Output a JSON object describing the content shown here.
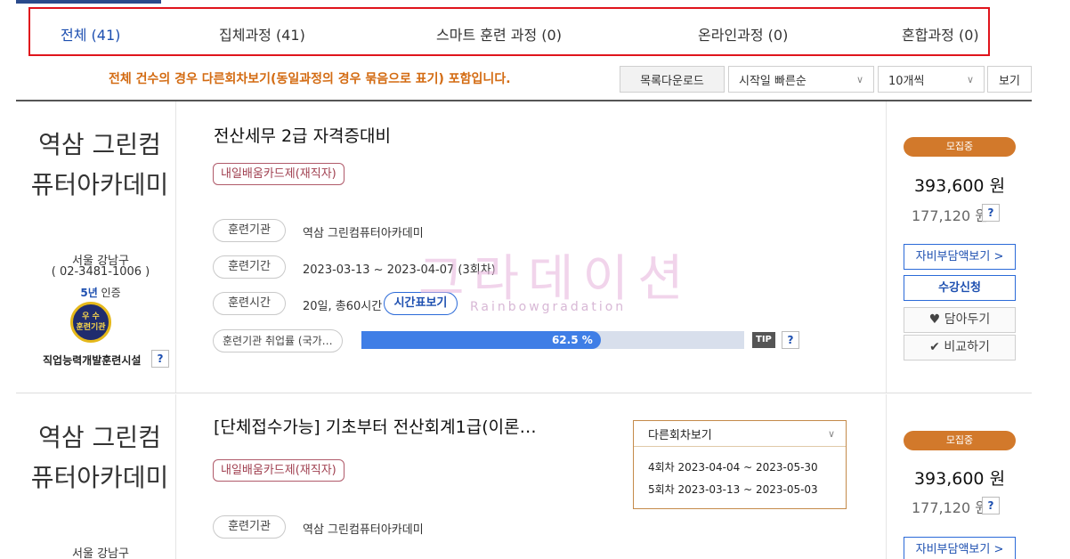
{
  "tabs": [
    {
      "label": "전체 (41)",
      "active": true
    },
    {
      "label": "집체과정 (41)",
      "active": false
    },
    {
      "label": "스마트 훈련 과정 (0)",
      "active": false
    },
    {
      "label": "온라인과정 (0)",
      "active": false
    },
    {
      "label": "혼합과정 (0)",
      "active": false
    }
  ],
  "notice": "전체 건수의 경우 다른회차보기(동일과정의 경우 묶음으로 표기) 포함입니다.",
  "toolbar": {
    "download_label": "목록다운로드",
    "sort_value": "시작일 빠른순",
    "page_size_value": "10개씩",
    "view_label": "보기"
  },
  "watermark": {
    "main": "그라데이션",
    "sub": "Rainbowgradation"
  },
  "courses": [
    {
      "org_name": "역삼 그린컴퓨터아카데미",
      "org_addr": "서울 강남구",
      "org_phone": "( 02-3481-1006 )",
      "cert_years": "5년",
      "cert_suffix": " 인증",
      "medal_text": "우 수\n훈련기관",
      "org_type": "직업능력개발훈련시설",
      "title": "전산세무 2급 자격증대비",
      "tag": "내일배움카드제(재직자)",
      "labels": {
        "org": "훈련기관",
        "period": "훈련기간",
        "time": "훈련시간",
        "employment": "훈련기관 취업률 (국가…"
      },
      "org_value": "역삼 그린컴퓨터아카데미",
      "period_value": "2023-03-13 ~ 2023-04-07 (3회차)",
      "time_value": "20일, 총60시간",
      "timetable_label": "시간표보기",
      "employment_rate": 62.5,
      "employment_label": "62.5 %",
      "tip_label": "TIP",
      "status": "모집중",
      "price": "393,600 원",
      "price_sub": "177,120 원",
      "self_pay_label": "자비부담액보기 >",
      "apply_label": "수강신청",
      "wish_label": "담아두기",
      "compare_label": "비교하기",
      "help": "?"
    },
    {
      "org_name": "역삼 그린컴퓨터아카데미",
      "org_addr": "서울 강남구",
      "title": "[단체접수가능] 기초부터 전산회계1급(이론…",
      "tag": "내일배움카드제(재직자)",
      "labels": {
        "org": "훈련기관"
      },
      "org_value": "역삼 그린컴퓨터아카데미",
      "rounds_title": "다른회차보기",
      "rounds": [
        "4회차 2023-04-04 ~ 2023-05-30",
        "5회차 2023-03-13 ~ 2023-05-03"
      ],
      "status": "모집중",
      "price": "393,600 원",
      "price_sub": "177,120 원",
      "self_pay_label": "자비부담액보기 >",
      "help": "?"
    }
  ],
  "colors": {
    "accent": "#1d4fb0",
    "status": "#d2792b",
    "notice": "#d36b12",
    "highlight": "#e0141c"
  }
}
